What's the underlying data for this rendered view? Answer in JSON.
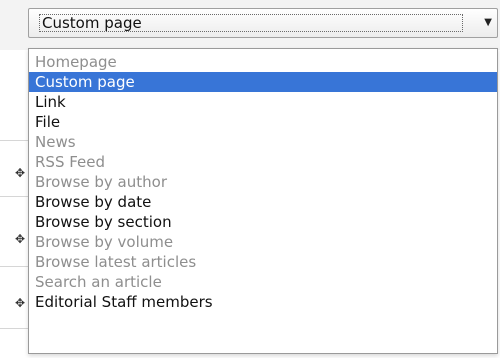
{
  "select": {
    "value": "Custom page",
    "arrow_icon": "triangle-down-icon"
  },
  "options": [
    {
      "label": "Homepage",
      "state": "disabled"
    },
    {
      "label": "Custom page",
      "state": "selected"
    },
    {
      "label": "Link",
      "state": "enabled"
    },
    {
      "label": "File",
      "state": "enabled"
    },
    {
      "label": "News",
      "state": "disabled"
    },
    {
      "label": "RSS Feed",
      "state": "disabled"
    },
    {
      "label": "Browse by author",
      "state": "disabled"
    },
    {
      "label": "Browse by date",
      "state": "enabled"
    },
    {
      "label": "Browse by section",
      "state": "enabled"
    },
    {
      "label": "Browse by volume",
      "state": "disabled"
    },
    {
      "label": "Browse latest articles",
      "state": "disabled"
    },
    {
      "label": "Search an article",
      "state": "disabled"
    },
    {
      "label": "Editorial Staff members",
      "state": "enabled"
    }
  ],
  "colors": {
    "selected_bg": "#3875d7",
    "disabled_text": "#8e8e8e",
    "enabled_text": "#111111"
  }
}
